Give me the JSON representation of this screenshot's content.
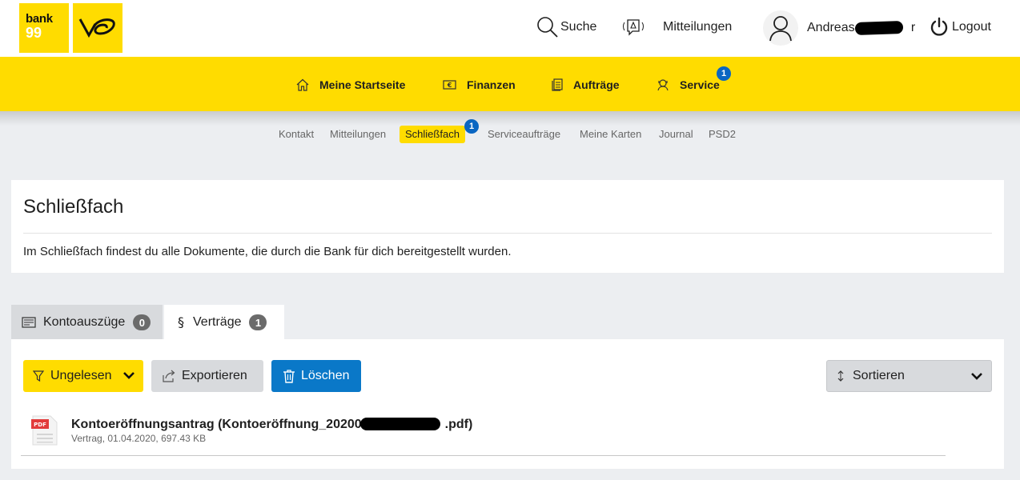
{
  "brand": {
    "bank_logo_line1": "bank",
    "bank_logo_line2": "99",
    "post_logo_icon": "posthorn-icon"
  },
  "header": {
    "search_label": "Suche",
    "messages_label": "Mitteilungen",
    "user_name": "Andreas Gr",
    "user_name_suffix": "r",
    "logout_label": "Logout"
  },
  "mainnav": {
    "items": [
      {
        "label": "Meine Startseite",
        "icon": "home-icon"
      },
      {
        "label": "Finanzen",
        "icon": "money-icon"
      },
      {
        "label": "Aufträge",
        "icon": "document-icon"
      },
      {
        "label": "Service",
        "icon": "service-icon",
        "badge": "1"
      }
    ]
  },
  "subnav": {
    "items": [
      {
        "label": "Kontakt"
      },
      {
        "label": "Mitteilungen"
      },
      {
        "label": "Schließfach",
        "active": true,
        "badge": "1"
      },
      {
        "label": "Serviceaufträge"
      },
      {
        "label": "Meine Karten"
      },
      {
        "label": "Journal"
      },
      {
        "label": "PSD2"
      }
    ]
  },
  "intro": {
    "title": "Schließfach",
    "text": "Im Schließfach findest du alle Dokumente, die durch die Bank für dich bereitgestellt wurden."
  },
  "tabs": [
    {
      "label": "Kontoauszüge",
      "count": "0",
      "active": false
    },
    {
      "label": "Verträge",
      "count": "1",
      "active": true
    }
  ],
  "toolbar": {
    "filter_label": "Ungelesen",
    "export_label": "Exportieren",
    "delete_label": "Löschen",
    "sort_label": "Sortieren"
  },
  "documents": [
    {
      "title_start": "Kontoeröffnungsantrag (Kontoeröffnung_20200",
      "title_end": ".pdf)",
      "meta": "Vertrag, 01.04.2020, 697.43 KB",
      "icon": "pdf-icon",
      "icon_label": "PDF"
    }
  ],
  "colors": {
    "accent_yellow": "#ffdc00",
    "badge_blue": "#0a66c2",
    "delete_blue": "#0a78c8",
    "background": "#eceef1"
  }
}
